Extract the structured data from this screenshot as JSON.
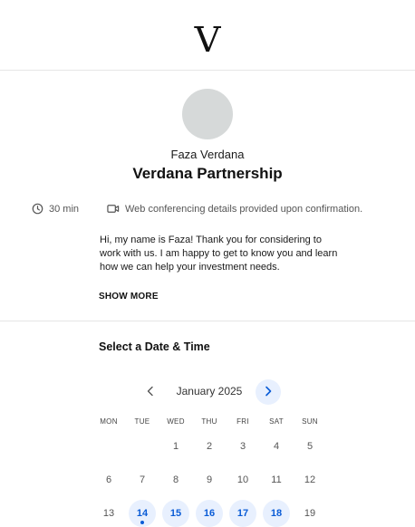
{
  "header": {
    "logo_letter": "V",
    "logo_icon": "verdana-logo"
  },
  "profile": {
    "host_name": "Faza Verdana",
    "event_title": "Verdana Partnership",
    "duration": "30 min",
    "duration_icon": "clock-icon",
    "location": "Web conferencing details provided upon confirmation.",
    "location_icon": "video-camera-icon",
    "description": "Hi, my name is Faza! Thank you for considering to work with us. I am happy to get to know you and learn how we can help your investment needs.",
    "show_more": "SHOW MORE"
  },
  "picker": {
    "title": "Select a Date & Time",
    "month": "January 2025",
    "prev_icon": "chevron-left-icon",
    "next_icon": "chevron-right-icon",
    "weekdays": [
      "MON",
      "TUE",
      "WED",
      "THU",
      "FRI",
      "SAT",
      "SUN"
    ],
    "weeks": [
      [
        {
          "day": "",
          "available": false
        },
        {
          "day": "",
          "available": false
        },
        {
          "day": "1",
          "available": false
        },
        {
          "day": "2",
          "available": false
        },
        {
          "day": "3",
          "available": false
        },
        {
          "day": "4",
          "available": false
        },
        {
          "day": "5",
          "available": false
        }
      ],
      [
        {
          "day": "6",
          "available": false
        },
        {
          "day": "7",
          "available": false
        },
        {
          "day": "8",
          "available": false
        },
        {
          "day": "9",
          "available": false
        },
        {
          "day": "10",
          "available": false
        },
        {
          "day": "11",
          "available": false
        },
        {
          "day": "12",
          "available": false
        }
      ],
      [
        {
          "day": "13",
          "available": false
        },
        {
          "day": "14",
          "available": true,
          "today": true
        },
        {
          "day": "15",
          "available": true
        },
        {
          "day": "16",
          "available": true
        },
        {
          "day": "17",
          "available": true
        },
        {
          "day": "18",
          "available": true
        },
        {
          "day": "19",
          "available": false
        }
      ]
    ]
  },
  "colors": {
    "accent": "#0a5cd6",
    "available_bg": "#e8f0fe",
    "avatar": "#d6d9d9",
    "divider": "#e6e6e6"
  }
}
